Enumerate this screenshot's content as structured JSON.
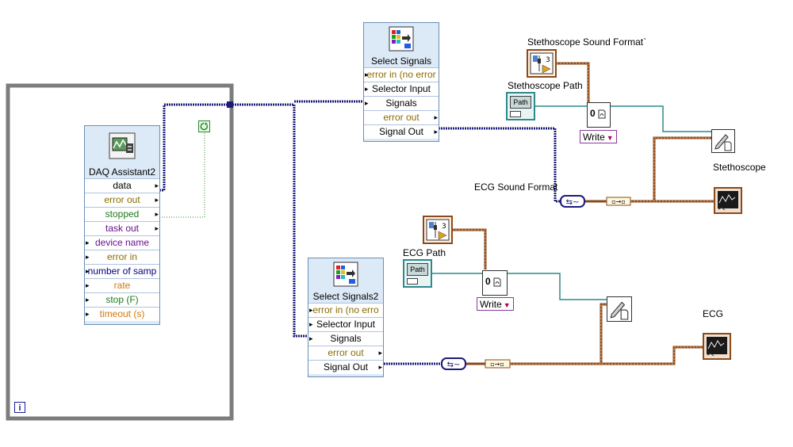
{
  "loop": {
    "iteration_label": "i"
  },
  "daq": {
    "title": "DAQ Assistant2",
    "terminals": [
      "data",
      "error out",
      "stopped",
      "task out",
      "device name",
      "error in",
      "number of samp",
      "rate",
      "stop (F)",
      "timeout (s)"
    ]
  },
  "select1": {
    "title": "Select Signals",
    "terminals": [
      "error in (no error",
      "Selector Input",
      "Signals",
      "error out",
      "Signal Out"
    ]
  },
  "select2": {
    "title": "Select Signals2",
    "terminals": [
      "error in (no erro",
      "Selector Input",
      "Signals",
      "error out",
      "Signal Out"
    ]
  },
  "labels": {
    "steth_sound_format": "Stethoscope Sound Format`",
    "steth_path": "Stethoscope Path",
    "stethoscope": "Stethoscope",
    "ecg_sound_format": "ECG Sound Format",
    "ecg_path": "ECG Path",
    "ecg": "ECG"
  },
  "controls": {
    "path_text": "Path",
    "open_num": "0",
    "write_label_1": "Write",
    "write_label_2": "Write",
    "const_3": "3"
  },
  "colors": {
    "dynamic_wire": "#1b1b7a",
    "path_wire": "#2b8a8a",
    "cluster_wire": "#8a4a1a",
    "boolean_wire": "#2a8a2a",
    "loop_border": "#808080",
    "node_fill": "#dce9f6"
  }
}
